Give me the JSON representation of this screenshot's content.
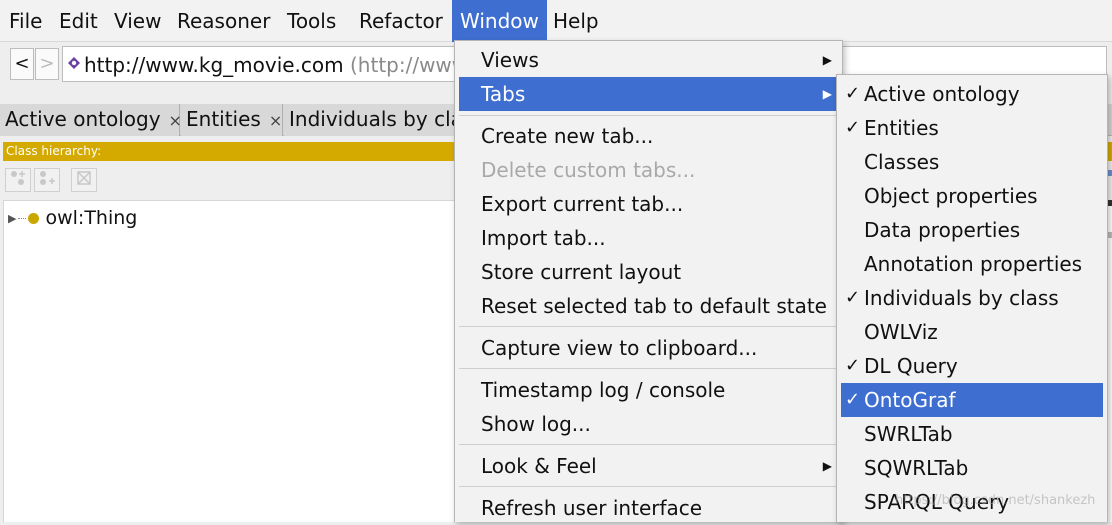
{
  "menubar": {
    "items": [
      "File",
      "Edit",
      "View",
      "Reasoner",
      "Tools",
      "Refactor",
      "Window",
      "Help"
    ],
    "active": "Window"
  },
  "address": {
    "back_label": "<",
    "forward_label": ">",
    "iri": "http://www.kg_movie.com",
    "iri_suffix": "(http://www.k"
  },
  "tabs": [
    {
      "label": "Active ontology",
      "close": "×"
    },
    {
      "label": "Entities",
      "close": "×"
    },
    {
      "label": "Individuals by cla",
      "close": ""
    }
  ],
  "class_hierarchy": {
    "title": "Class hierarchy:",
    "tree": [
      {
        "label": "owl:Thing",
        "expanded": false
      }
    ]
  },
  "window_menu": {
    "items": [
      {
        "label": "Views",
        "submenu": true,
        "arrow": "▶"
      },
      {
        "label": "Tabs",
        "submenu": true,
        "highlighted": true,
        "arrow": "▶"
      },
      {
        "label": "Create new tab..."
      },
      {
        "label": "Delete custom tabs...",
        "disabled": true
      },
      {
        "label": "Export current tab..."
      },
      {
        "label": "Import tab..."
      },
      {
        "label": "Store current layout"
      },
      {
        "label": "Reset selected tab to default state"
      },
      {
        "label": "Capture view to clipboard..."
      },
      {
        "label": "Timestamp log / console"
      },
      {
        "label": "Show log..."
      },
      {
        "label": "Look & Feel",
        "submenu": true,
        "arrow": "▶"
      },
      {
        "label": "Refresh user interface"
      }
    ]
  },
  "tabs_submenu": {
    "check_glyph": "✓",
    "items": [
      {
        "label": "Active ontology",
        "checked": true
      },
      {
        "label": "Entities",
        "checked": true
      },
      {
        "label": "Classes",
        "checked": false
      },
      {
        "label": "Object properties",
        "checked": false
      },
      {
        "label": "Data properties",
        "checked": false
      },
      {
        "label": "Annotation properties",
        "checked": false
      },
      {
        "label": "Individuals by class",
        "checked": true
      },
      {
        "label": "OWLViz",
        "checked": false
      },
      {
        "label": "DL Query",
        "checked": true
      },
      {
        "label": "OntoGraf",
        "checked": true,
        "highlighted": true
      },
      {
        "label": "SWRLTab",
        "checked": false
      },
      {
        "label": "SQWRLTab",
        "checked": false
      },
      {
        "label": "SPARQL Query",
        "checked": false
      }
    ]
  },
  "watermark": "https://blog.csdn.net/shankezh",
  "colors": {
    "highlight": "#3e6fd0",
    "class_bar": "#d4aa00",
    "thing_dot": "#c9a600"
  }
}
